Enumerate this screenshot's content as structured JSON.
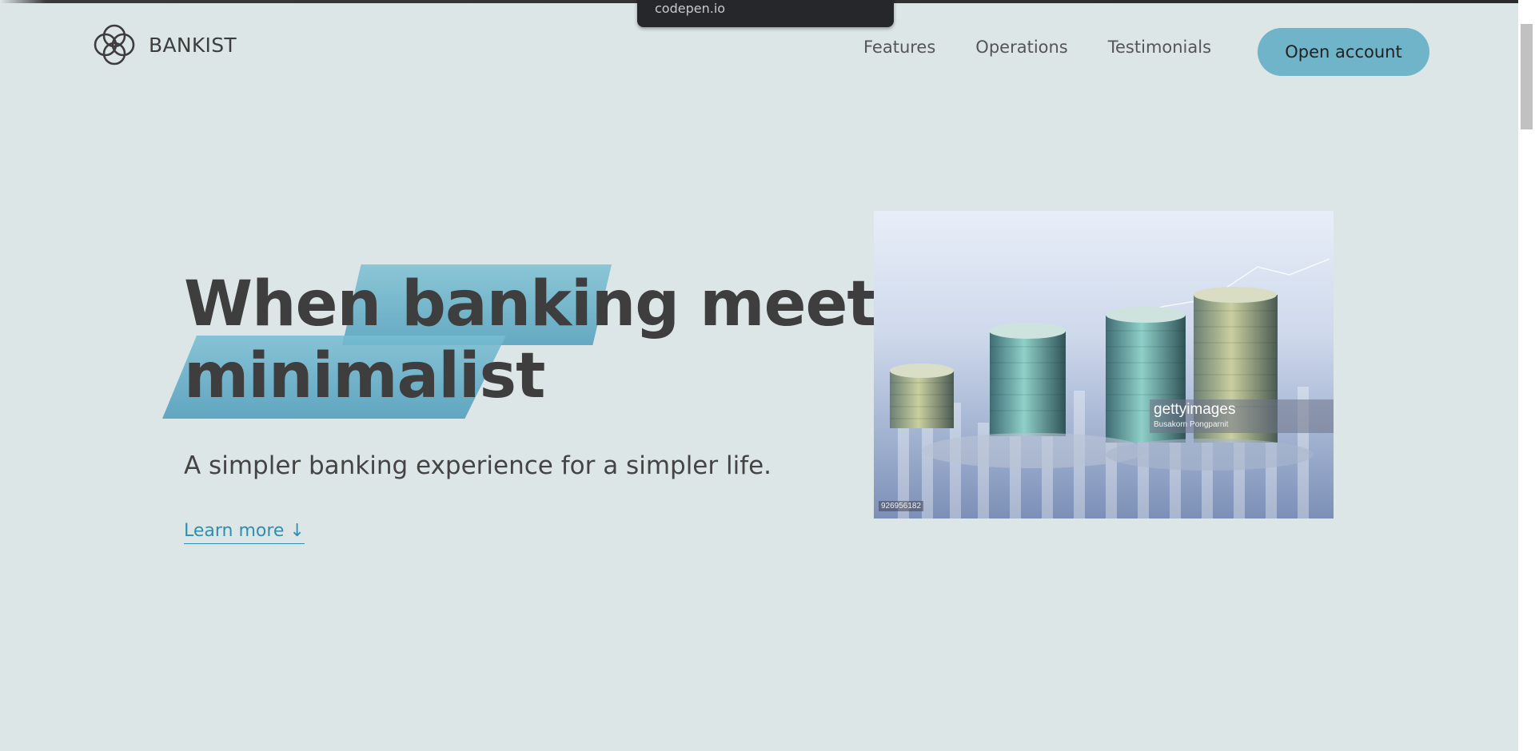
{
  "browser": {
    "tooltip_url": "codepen.io"
  },
  "brand": {
    "name": "BANKIST",
    "logo_icon": "four-interlocking-circles-icon"
  },
  "nav": {
    "items": [
      {
        "label": "Features"
      },
      {
        "label": "Operations"
      },
      {
        "label": "Testimonials"
      }
    ],
    "cta_label": "Open account"
  },
  "hero": {
    "headline_line1_a": "When ",
    "headline_highlight": "banking",
    "headline_line1_b": " meets",
    "headline_line2": "minimalist",
    "subtitle": "A simpler banking experience for a simpler life.",
    "learn_more": "Learn more ↓",
    "image": {
      "watermark_brand": "gettyimages",
      "watermark_credit": "Busakorn Pongparnit",
      "image_id": "926956182"
    }
  },
  "colors": {
    "background": "#dde6e6",
    "accent": "#6fb4c8",
    "highlight": "#5cabc5",
    "text": "#444444",
    "link": "#2f8fb0"
  }
}
